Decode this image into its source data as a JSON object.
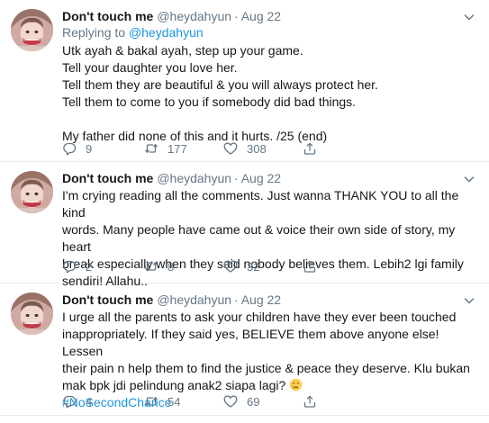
{
  "colors": {
    "link": "#1b95e0",
    "secondary": "#657786",
    "text": "#14171a",
    "divider": "#e6ecf0"
  },
  "tweets": [
    {
      "name": "Don't touch me",
      "handle": "@heydahyun",
      "separator": "·",
      "time": "Aug 22",
      "replying_prefix": "Replying to",
      "replying_to": "@heydahyun",
      "lines": [
        "Utk ayah & bakal ayah, step up your game.",
        "Tell your daughter you love her.",
        "Tell them they are beautiful & you will always protect her.",
        "Tell them to come to you if somebody did bad things.",
        "",
        "My father did none of this and it hurts. /25 (end)"
      ],
      "replies": "9",
      "retweets": "177",
      "likes": "308"
    },
    {
      "name": "Don't touch me",
      "handle": "@heydahyun",
      "separator": "·",
      "time": "Aug 22",
      "lines": [
        "I'm crying reading all the comments. Just wanna THANK YOU to all the kind",
        "words. Many people have came out & voice their own side of story, my heart",
        "break especially when they said nobody believes them. Lebih2 lgi family",
        "sendiri! Allahu.."
      ],
      "replies": "2",
      "retweets": "8",
      "likes": "32"
    },
    {
      "name": "Don't touch me",
      "handle": "@heydahyun",
      "separator": "·",
      "time": "Aug 22",
      "lines": [
        "I urge all the parents to ask your children have they ever been touched",
        "inappropriately. If they said yes, BELIEVE them above anyone else! Lessen",
        "their pain n help them to find the justice & peace they deserve. Klu bukan",
        "mak bpk jdi pelindung anak2 siapa lagi?"
      ],
      "hashtag": "#NoSecondChance",
      "emoji": "crying-face-emoji",
      "replies": "4",
      "retweets": "54",
      "likes": "69"
    }
  ],
  "icons": {
    "more": "chevron-down-icon",
    "reply": "reply-icon",
    "retweet": "retweet-icon",
    "like": "heart-icon",
    "share": "share-icon"
  }
}
